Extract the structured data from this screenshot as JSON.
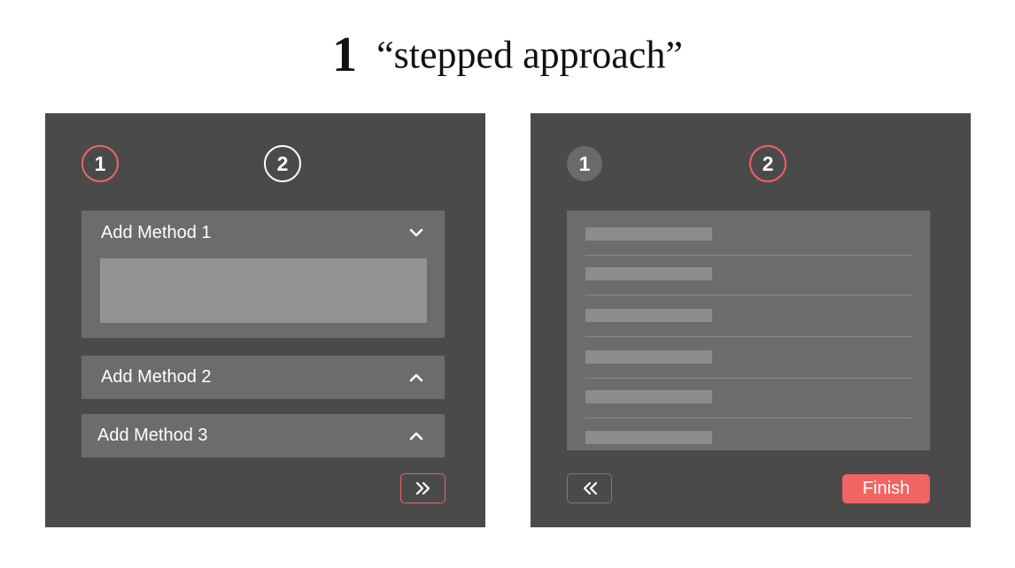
{
  "header": {
    "number": "1",
    "title": "“stepped approach”"
  },
  "left_panel": {
    "steps": [
      "1",
      "2"
    ],
    "accordions": [
      {
        "label": "Add Method 1",
        "state": "expanded"
      },
      {
        "label": "Add Method 2",
        "state": "collapsed"
      },
      {
        "label": "Add Method 3",
        "state": "collapsed"
      }
    ],
    "next_icon": "double-chevron-right-icon"
  },
  "right_panel": {
    "steps": [
      "1",
      "2"
    ],
    "list_rows": 6,
    "back_icon": "double-chevron-left-icon",
    "finish_label": "Finish"
  },
  "colors": {
    "accent": "#f06464",
    "panel_bg": "#4a4a4a",
    "card_bg": "#6c6c6c",
    "placeholder": "#939393"
  }
}
